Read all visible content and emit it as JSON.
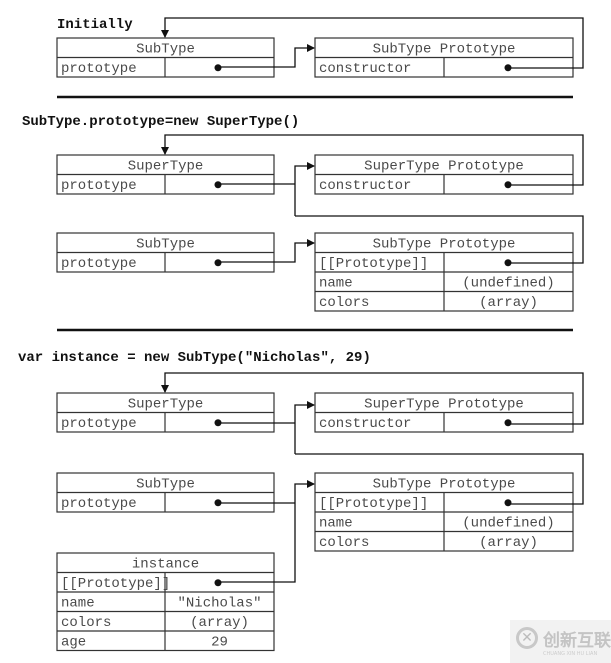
{
  "sections": [
    {
      "title": "Initially",
      "boxes": [
        {
          "title": "SubType",
          "rows": [
            [
              "prototype",
              ""
            ]
          ]
        },
        {
          "title": "SubType Prototype",
          "rows": [
            [
              "constructor",
              ""
            ]
          ]
        }
      ]
    },
    {
      "title": "SubType.prototype=new SuperType()",
      "boxes": [
        {
          "title": "SuperType",
          "rows": [
            [
              "prototype",
              ""
            ]
          ]
        },
        {
          "title": "SuperType Prototype",
          "rows": [
            [
              "constructor",
              ""
            ]
          ]
        },
        {
          "title": "SubType",
          "rows": [
            [
              "prototype",
              ""
            ]
          ]
        },
        {
          "title": "SubType Prototype",
          "rows": [
            [
              "[[Prototype]]",
              ""
            ],
            [
              "name",
              "(undefined)"
            ],
            [
              "colors",
              "(array)"
            ]
          ]
        }
      ]
    },
    {
      "title": "var instance = new SubType(\"Nicholas\", 29)",
      "boxes": [
        {
          "title": "SuperType",
          "rows": [
            [
              "prototype",
              ""
            ]
          ]
        },
        {
          "title": "SuperType Prototype",
          "rows": [
            [
              "constructor",
              ""
            ]
          ]
        },
        {
          "title": "SubType",
          "rows": [
            [
              "prototype",
              ""
            ]
          ]
        },
        {
          "title": "SubType Prototype",
          "rows": [
            [
              "[[Prototype]]",
              ""
            ],
            [
              "name",
              "(undefined)"
            ],
            [
              "colors",
              "(array)"
            ]
          ]
        },
        {
          "title": "instance",
          "rows": [
            [
              "[[Prototype]]",
              ""
            ],
            [
              "name",
              "\"Nicholas\""
            ],
            [
              "colors",
              "(array)"
            ],
            [
              "age",
              "29"
            ]
          ]
        }
      ]
    }
  ],
  "watermark": {
    "text": "创新互联",
    "sub": "CHUANG XIN HU LIAN"
  }
}
